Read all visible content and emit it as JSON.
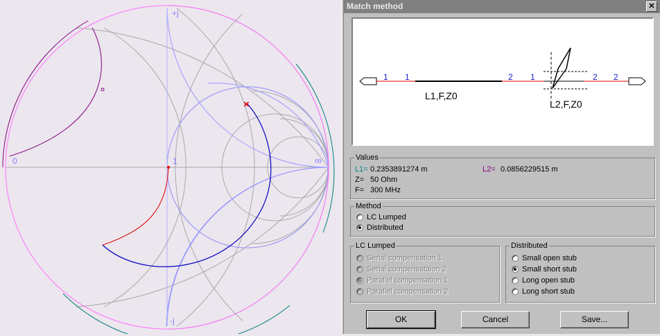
{
  "smith": {
    "label_plus_j": "+j",
    "label_minus_j": "-j",
    "label_zero": "0",
    "label_one": "1",
    "label_inf": "∞",
    "marker_x": "×",
    "colors": {
      "red": "#e00000",
      "blue": "#0000c0",
      "purple": "#800080",
      "teal": "#008080",
      "pink": "#ff70ff",
      "grey": "#a0a0a0",
      "lavender": "#8c8cff"
    }
  },
  "dialog": {
    "title": "Match method",
    "close_label": "✕",
    "schematic": {
      "label_l1": "L1,F,Z0",
      "label_l2": "L2,F,Z0",
      "port_1a": "1",
      "port_1b": "1",
      "port_2a": "2",
      "port_1c": "1",
      "port_2b": "2",
      "port_2c": "2"
    },
    "values": {
      "legend": "Values",
      "l1_key": "L1=",
      "l1_value": "0.2353891274 m",
      "l2_key": "L2=",
      "l2_value": "0.0856229515 m",
      "z_key": "Z=",
      "z_value": "50 Ohm",
      "f_key": "F=",
      "f_value": "300 MHz"
    },
    "method": {
      "legend": "Method",
      "options": [
        {
          "label": "LC Lumped",
          "selected": false
        },
        {
          "label": "Distributed",
          "selected": true
        }
      ]
    },
    "lc_lumped": {
      "legend": "LC Lumped",
      "options": [
        {
          "label": "Serial compensation 1",
          "selected": false
        },
        {
          "label": "Serial compensataion 2",
          "selected": false
        },
        {
          "label": "Parallel compensation 1",
          "selected": true
        },
        {
          "label": "Parallel compensation 2",
          "selected": false
        }
      ]
    },
    "distributed": {
      "legend": "Distributed",
      "options": [
        {
          "label": "Small open stub",
          "selected": false
        },
        {
          "label": "Small short stub",
          "selected": true
        },
        {
          "label": "Long open stub",
          "selected": false
        },
        {
          "label": "Long short stub",
          "selected": false
        }
      ]
    },
    "buttons": {
      "ok": "OK",
      "cancel": "Cancel",
      "save": "Save..."
    }
  }
}
